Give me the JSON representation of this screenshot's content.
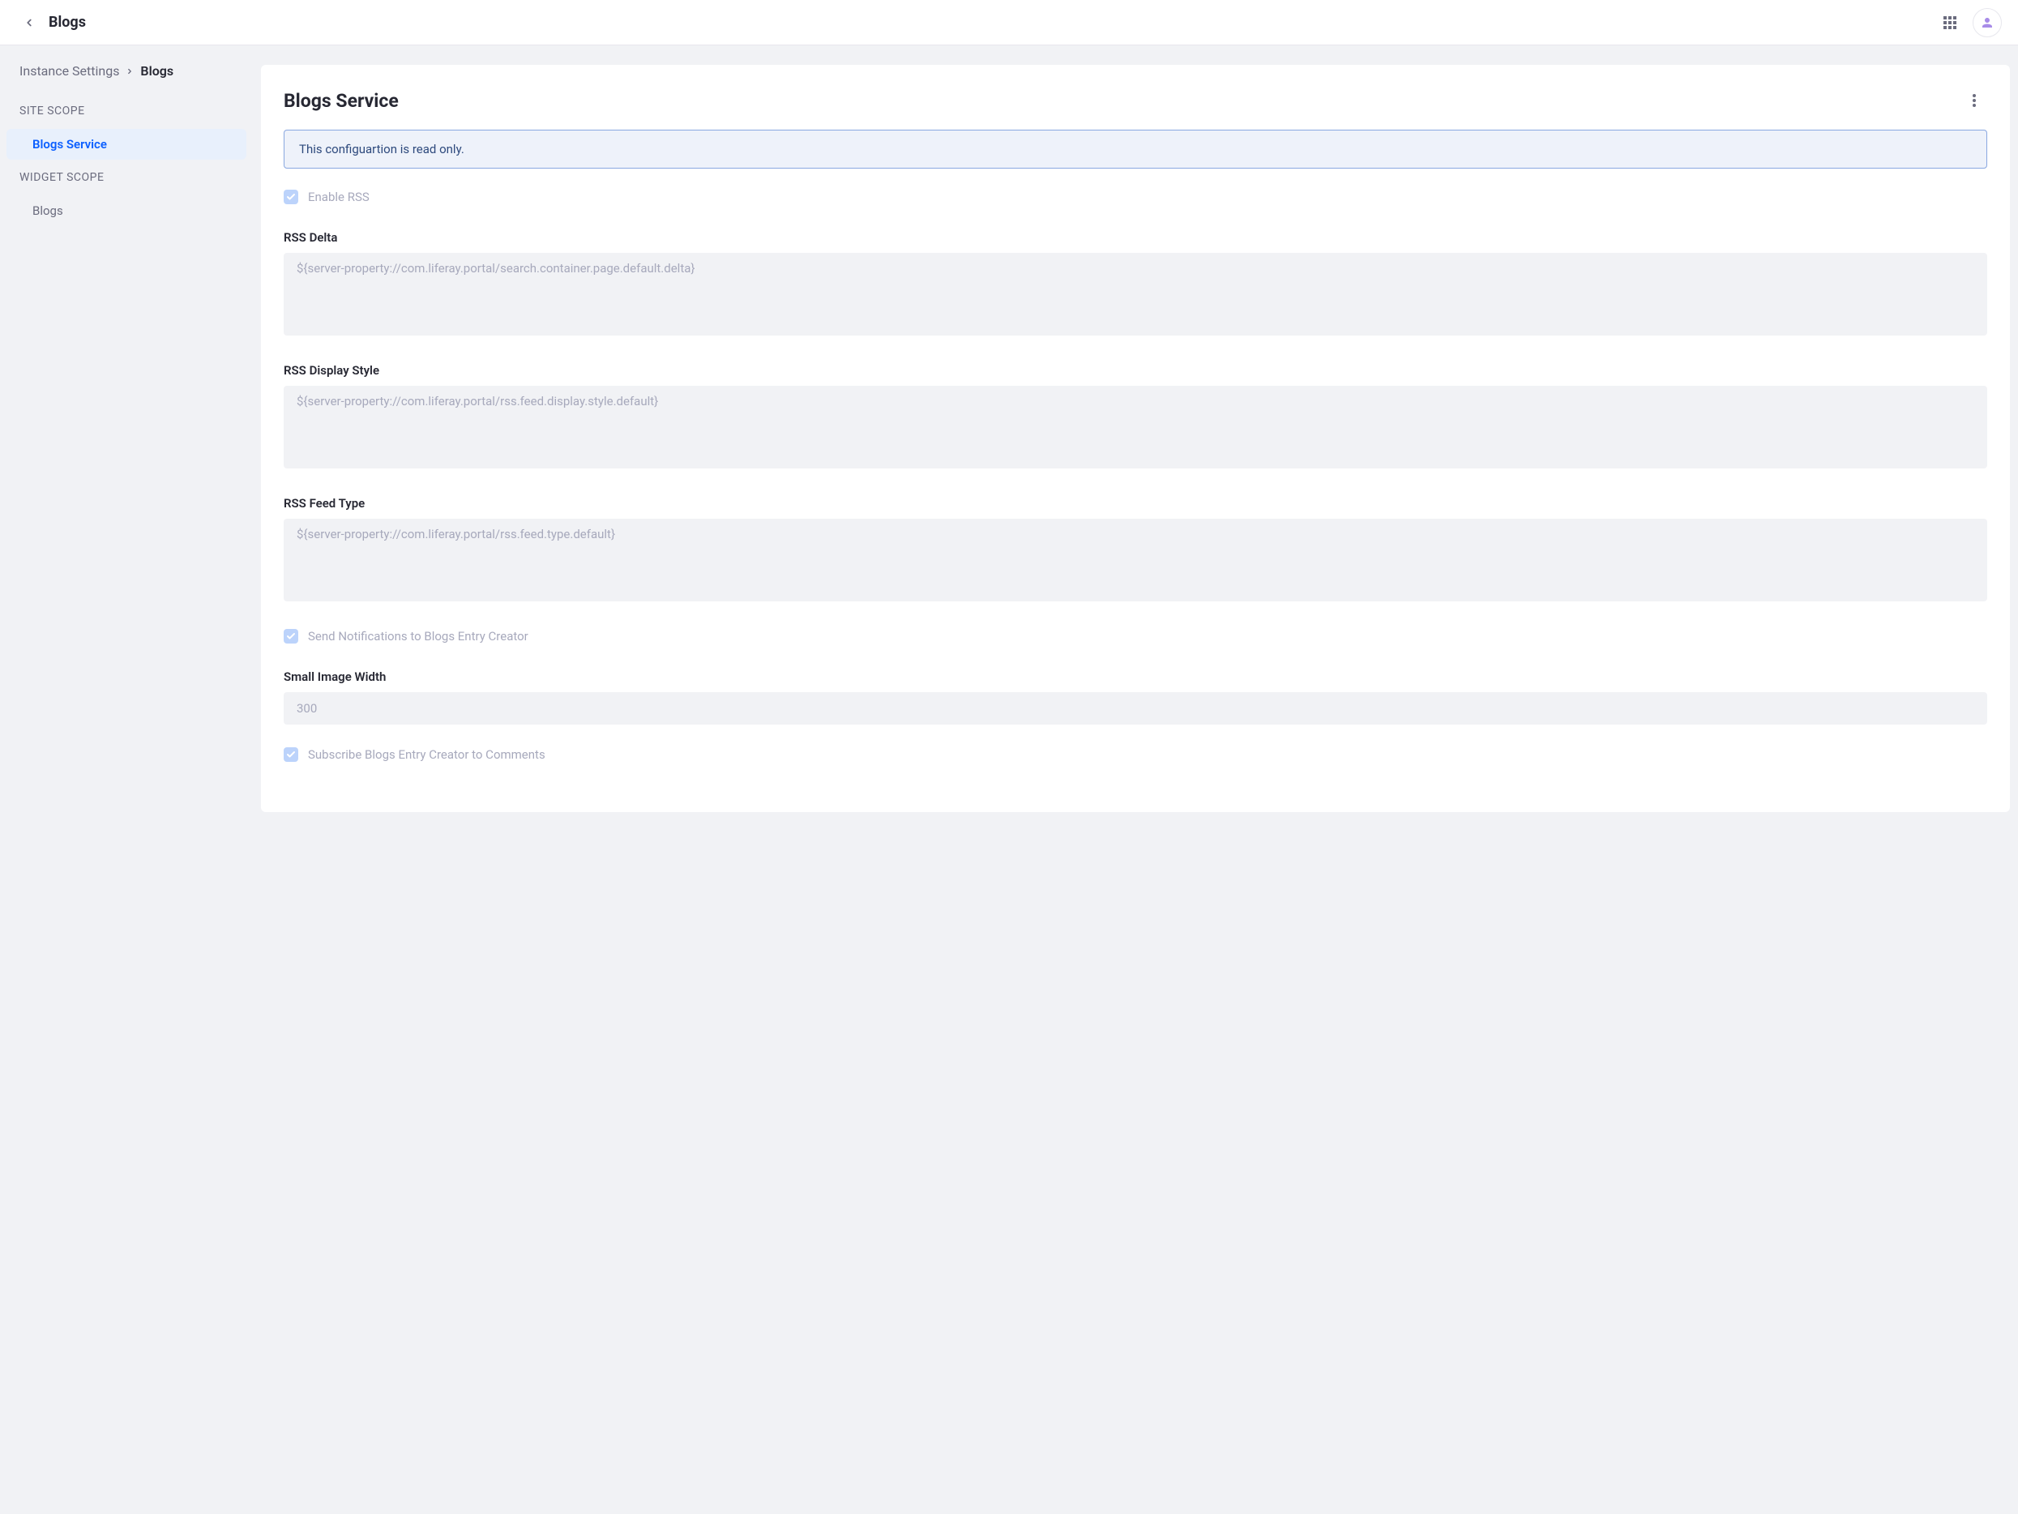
{
  "topbar": {
    "title": "Blogs"
  },
  "breadcrumb": {
    "parent": "Instance Settings",
    "current": "Blogs"
  },
  "sidebar": {
    "scope1_label": "SITE SCOPE",
    "scope1_items": [
      {
        "label": "Blogs Service",
        "active": true
      }
    ],
    "scope2_label": "WIDGET SCOPE",
    "scope2_items": [
      {
        "label": "Blogs",
        "active": false
      }
    ]
  },
  "main": {
    "title": "Blogs Service",
    "alert": "This configuartion is read only.",
    "enable_rss_label": "Enable RSS",
    "rss_delta": {
      "label": "RSS Delta",
      "value": "${server-property://com.liferay.portal/search.container.page.default.delta}"
    },
    "rss_display_style": {
      "label": "RSS Display Style",
      "value": "${server-property://com.liferay.portal/rss.feed.display.style.default}"
    },
    "rss_feed_type": {
      "label": "RSS Feed Type",
      "value": "${server-property://com.liferay.portal/rss.feed.type.default}"
    },
    "send_notifications_label": "Send Notifications to Blogs Entry Creator",
    "small_image_width": {
      "label": "Small Image Width",
      "value": "300"
    },
    "subscribe_label": "Subscribe Blogs Entry Creator to Comments"
  }
}
